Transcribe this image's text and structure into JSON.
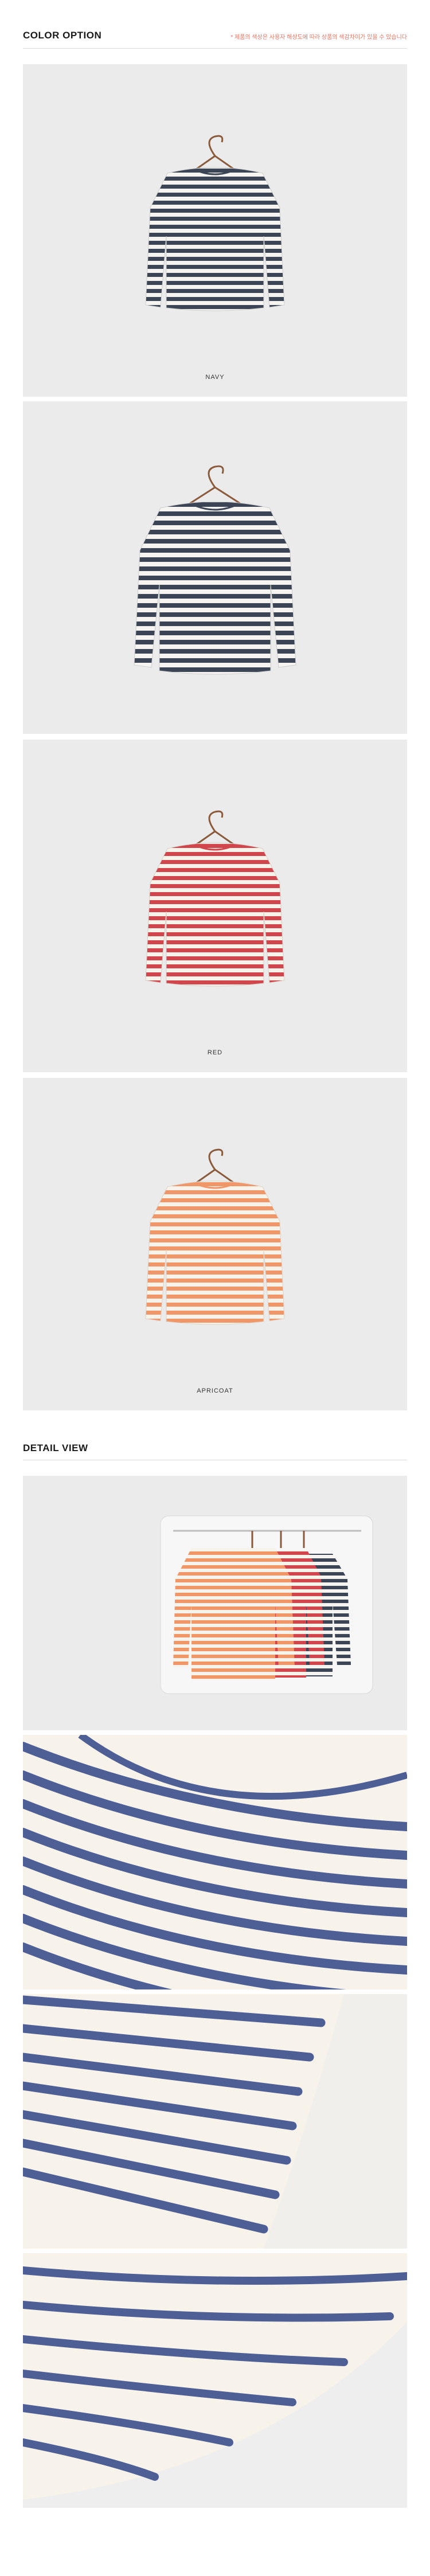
{
  "color_option": {
    "title": "COLOR OPTION",
    "note": "* 제품의 색상은 사용자 해상도에 따라 상품의 색감차이가 있을 수 있습니다"
  },
  "panels": [
    {
      "caption": "NAVY",
      "stripe": "#3c4556"
    },
    {
      "caption": "",
      "stripe": "#3c4556"
    },
    {
      "caption": "RED",
      "stripe": "#d1454d"
    },
    {
      "caption": "APRICOAT",
      "stripe": "#f0976a"
    }
  ],
  "detail_view": {
    "title": "DETAIL VIEW"
  },
  "colors": {
    "panel_bg": "#ebebeb",
    "navy": "#3c4556",
    "red": "#d1454d",
    "apricot": "#f0976a",
    "cream": "#f7f2ea",
    "detail_blue": "#4e5f95",
    "note": "#e2735f"
  }
}
